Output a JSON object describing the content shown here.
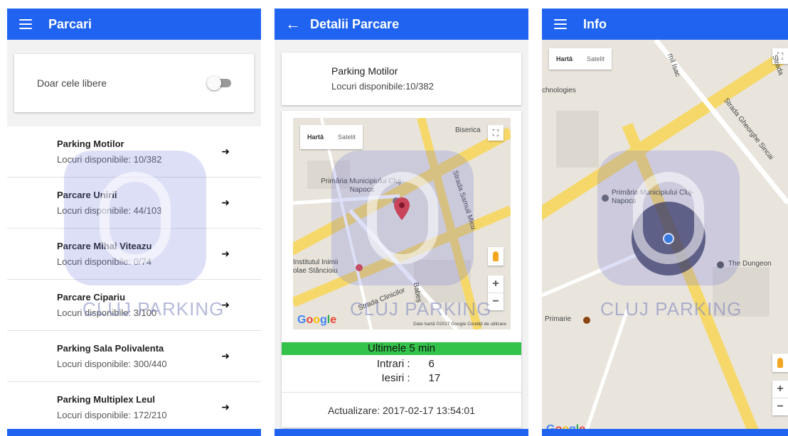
{
  "screen1": {
    "title": "Parcari",
    "filter_label": "Doar cele libere",
    "items": [
      {
        "name": "Parking Motilor",
        "available": "Locuri disponibile: 10/382"
      },
      {
        "name": "Parcare Unirii",
        "available": "Locuri disponibile: 44/103"
      },
      {
        "name": "Parcare Mihai Viteazu",
        "available": "Locuri disponibile: 0/74"
      },
      {
        "name": "Parcare Cipariu",
        "available": "Locuri disponibile: 3/100"
      },
      {
        "name": "Parking Sala Polivalenta",
        "available": "Locuri disponibile: 300/440"
      },
      {
        "name": "Parking Multiplex Leul",
        "available": "Locuri disponibile: 172/210"
      }
    ],
    "arrow": "➜"
  },
  "screen2": {
    "title": "Detalii Parcare",
    "back": "←",
    "parking_name": "Parking Motilor",
    "parking_available": "Locuri disponibile:10/382",
    "map": {
      "type_map": "Hartă",
      "type_satellite": "Satelit",
      "label_primaria": "Primăria Municipiului Cluj-Napoca",
      "label_institut": "Institutul Inimii",
      "label_institut2": "olae Stăncioiu",
      "label_clinicilor": "Strada Clinicilor",
      "label_samuil": "Strada Samuil Micu",
      "label_biserica": "Biserica",
      "label_babes": "Babeș",
      "attribution": "Date hartă ©2017 Google   Condiții de utilizare",
      "google": [
        "G",
        "o",
        "o",
        "g",
        "l",
        "e"
      ]
    },
    "recent_header": "Ultimele 5 min",
    "entries_label": "Intrari :",
    "entries_value": "6",
    "exits_label": "Iesiri :",
    "exits_value": "17",
    "updated": "Actualizare: 2017-02-17 13:54:01"
  },
  "screen3": {
    "title": "Info",
    "map": {
      "type_map": "Hartă",
      "type_satellite": "Satelit",
      "label_technologies": "chnologies",
      "label_primaria": "Primăria Municipiului Cluj-Napoca",
      "label_dungeon": "The Dungeon",
      "label_primarie": "Primarie",
      "label_sincai": "Strada Gheorghe Sincai",
      "label_isac": "mil Isac",
      "label_strada": "Strada",
      "google": [
        "G",
        "o",
        "o",
        "g",
        "l",
        "e"
      ]
    }
  },
  "watermark": "CLUJ PARKING",
  "colors": {
    "appbar": "#1f63f0",
    "green": "#33c24a",
    "map_road": "#f6d86a"
  }
}
